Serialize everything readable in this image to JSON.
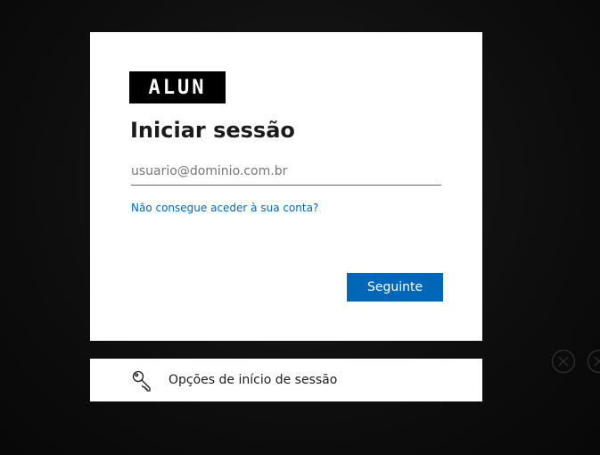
{
  "logo": {
    "text": "ALUN"
  },
  "signin": {
    "title": "Iniciar sessão",
    "email_placeholder": "usuario@dominio.com.br",
    "email_value": "",
    "help_link": "Não consegue aceder à sua conta?",
    "next_label": "Seguinte"
  },
  "options": {
    "label": "Opções de início de sessão",
    "icon": "key-icon"
  },
  "background": {
    "icons": [
      "close-circle-icon",
      "close-circle-icon"
    ]
  },
  "colors": {
    "accent": "#0067b8",
    "background": "#0e0e0e",
    "card": "#ffffff",
    "text": "#1b1b1b"
  }
}
